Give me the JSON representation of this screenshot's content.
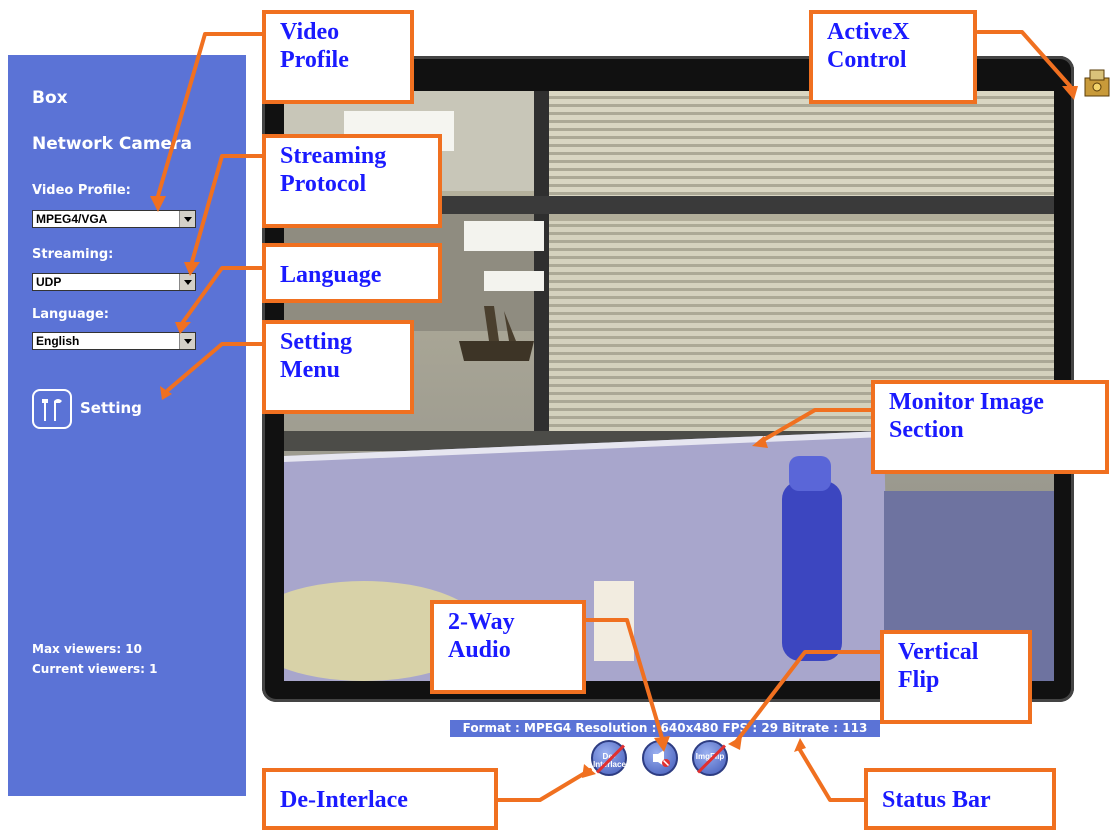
{
  "sidebar": {
    "title_line1": "Box",
    "title_line2": "Network Camera",
    "video_profile_label": "Video Profile:",
    "video_profile_value": "MPEG4/VGA",
    "streaming_label": "Streaming:",
    "streaming_value": "UDP",
    "language_label": "Language:",
    "language_value": "English",
    "setting_label": "Setting",
    "max_viewers": "Max viewers: 10",
    "current_viewers": "Current viewers:  1"
  },
  "status_bar": {
    "text": "Format : MPEG4   Resolution : 640x480   FPS : 29   Bitrate : 113"
  },
  "controls": {
    "deinterlace_label": "De-Interlace",
    "audio_label": "",
    "imgflip_label": "ImgFlip"
  },
  "callouts": {
    "video_profile": "Video Profile",
    "streaming_protocol": "Streaming Protocol",
    "language": "Language",
    "setting_menu": "Setting Menu",
    "activex_control": "ActiveX Control",
    "monitor_image_section": "Monitor Image Section",
    "two_way_audio": "2-Way Audio",
    "vertical_flip": "Vertical Flip",
    "de_interlace": "De-Interlace",
    "status_bar": "Status Bar"
  },
  "colors": {
    "sidebar": "#5b73d6",
    "callout_border": "#f07020",
    "callout_text": "#1a1aff"
  }
}
